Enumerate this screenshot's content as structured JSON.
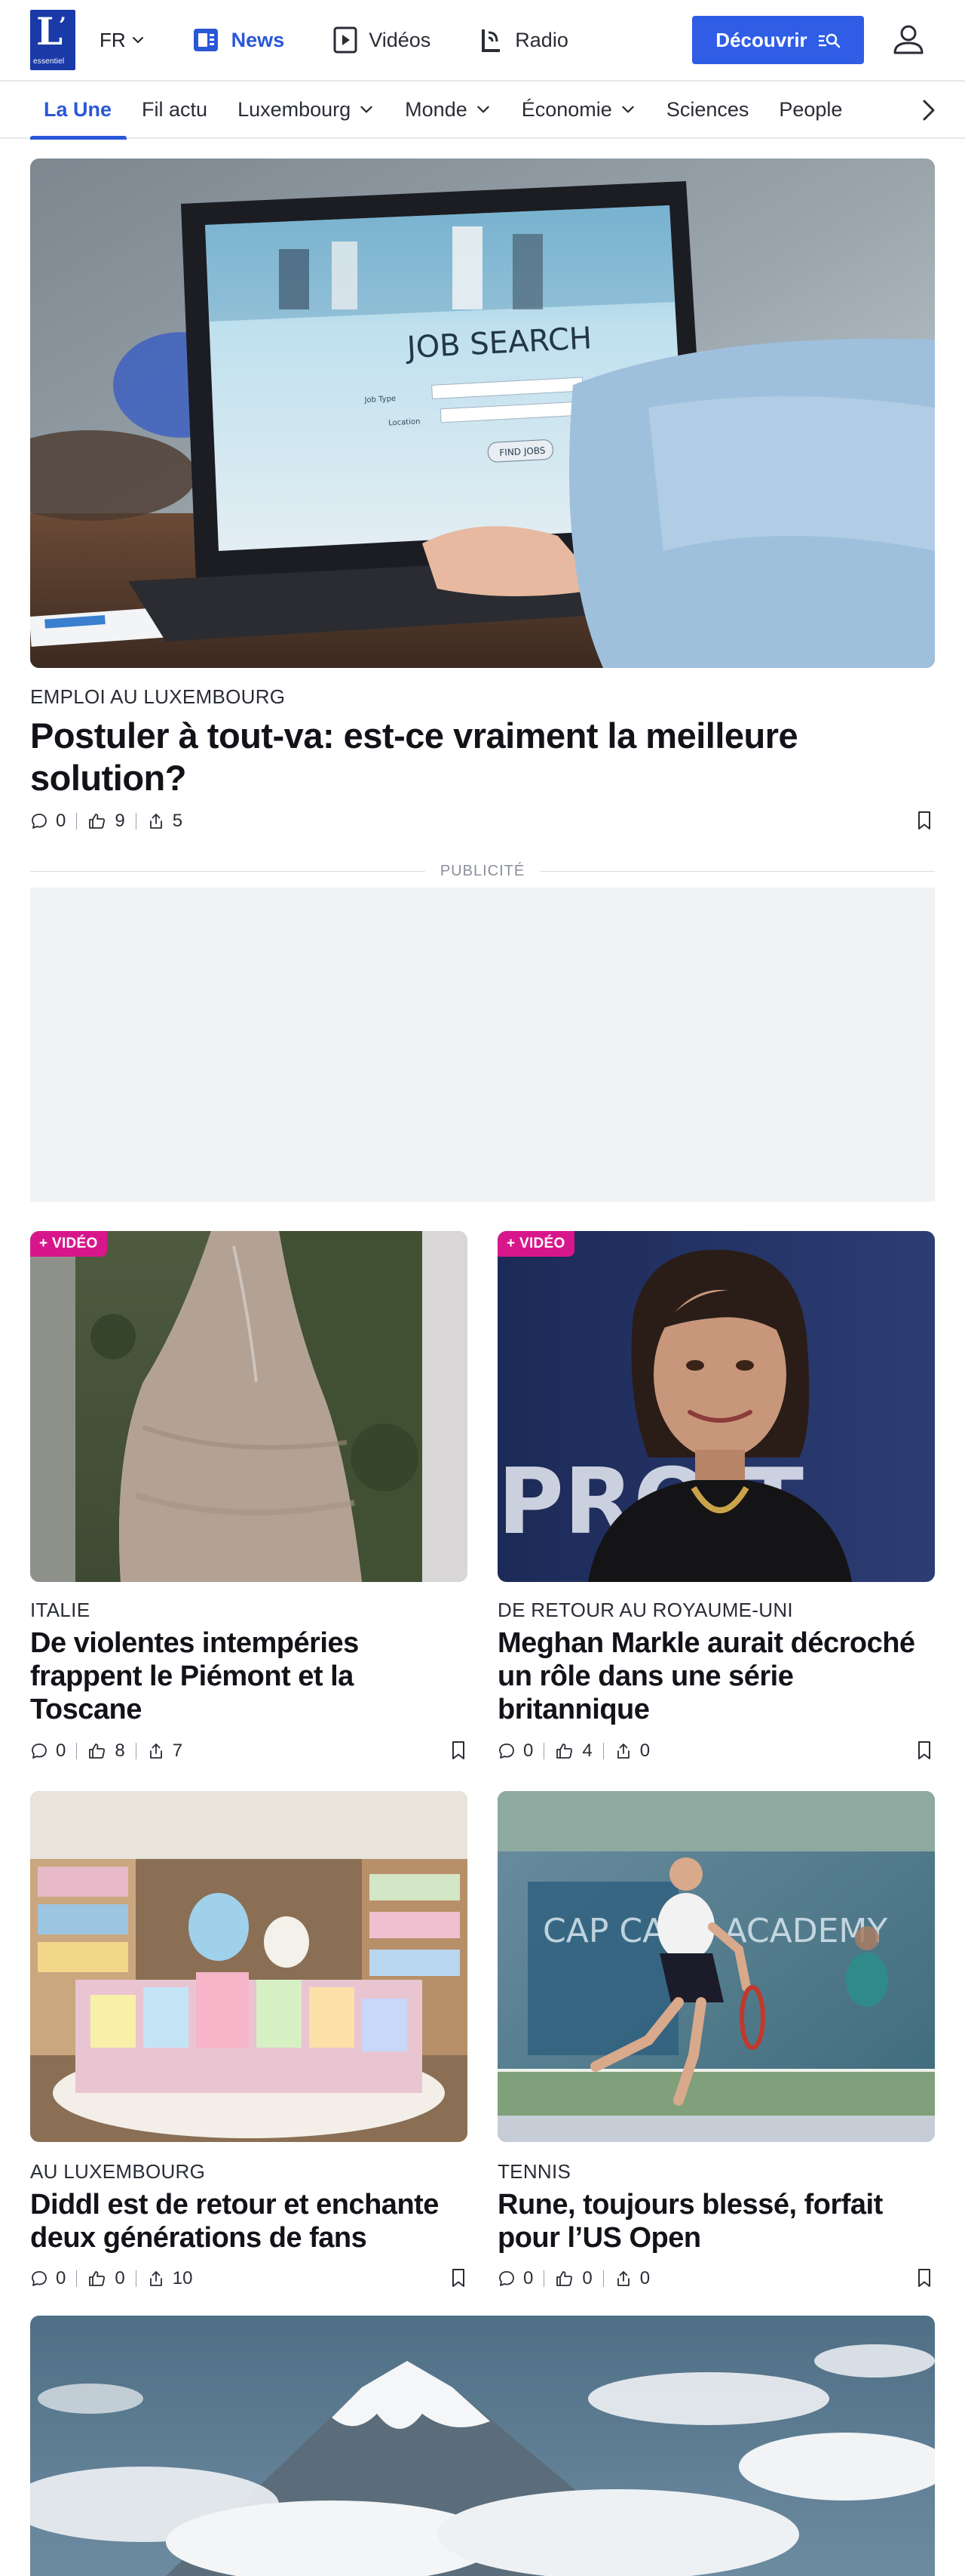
{
  "header": {
    "logo_letter": "L",
    "logo_apostrophe": "’",
    "logo_word": "essentiel",
    "language": "FR",
    "nav": [
      {
        "label": "News",
        "active": true,
        "icon": "newspaper-icon"
      },
      {
        "label": "Vidéos",
        "active": false,
        "icon": "play-icon"
      },
      {
        "label": "Radio",
        "active": false,
        "icon": "radio-icon"
      }
    ],
    "discover_label": "Découvrir",
    "accent": "#2f5de6"
  },
  "sections": [
    {
      "label": "La Une",
      "active": true,
      "dropdown": false
    },
    {
      "label": "Fil actu",
      "active": false,
      "dropdown": false
    },
    {
      "label": "Luxembourg",
      "active": false,
      "dropdown": true
    },
    {
      "label": "Monde",
      "active": false,
      "dropdown": true
    },
    {
      "label": "Économie",
      "active": false,
      "dropdown": true
    },
    {
      "label": "Sciences",
      "active": false,
      "dropdown": false
    },
    {
      "label": "People",
      "active": false,
      "dropdown": false
    }
  ],
  "hero": {
    "image_text": "JOB SEARCH",
    "image_button": "FIND JOBS",
    "image_field_1": "Job Type",
    "image_field_2": "Location",
    "kicker": "EMPLOI AU LUXEMBOURG",
    "title": "Postuler à tout-va: est-ce vraiment la meilleure solution?",
    "comments": "0",
    "likes": "9",
    "shares": "5"
  },
  "ad": {
    "label": "PUBLICITÉ"
  },
  "cards": [
    {
      "badge": "+ VIDÉO",
      "kicker": "ITALIE",
      "title": "De violentes intempéries frappent le Piémont et la Toscane",
      "comments": "0",
      "likes": "8",
      "shares": "7"
    },
    {
      "badge": "+ VIDÉO",
      "kicker": "DE RETOUR AU ROYAUME-UNI",
      "title": "Meghan Markle aurait décroché un rôle dans une série britannique",
      "comments": "0",
      "likes": "4",
      "shares": "0",
      "image_text": "PRO  T"
    },
    {
      "badge": "",
      "kicker": "AU LUXEMBOURG",
      "title": "Diddl est de retour et enchante deux générations de fans",
      "comments": "0",
      "likes": "0",
      "shares": "10"
    },
    {
      "badge": "",
      "kicker": "TENNIS",
      "title": "Rune, toujours blessé, forfait pour l’US Open",
      "comments": "0",
      "likes": "0",
      "shares": "0",
      "image_text": "CAP CARD ACADEMY"
    }
  ]
}
